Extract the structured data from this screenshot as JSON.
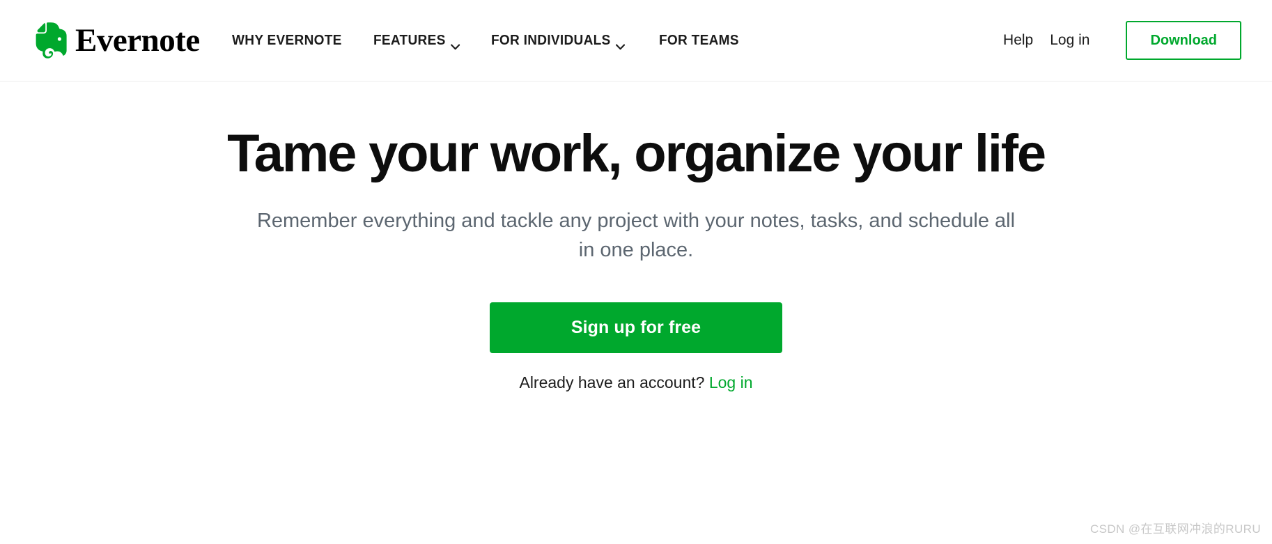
{
  "brand": {
    "name": "Evernote",
    "logo_icon": "evernote-elephant-icon",
    "logo_color": "#00a82d"
  },
  "header": {
    "nav": [
      {
        "label": "WHY EVERNOTE",
        "has_dropdown": false
      },
      {
        "label": "FEATURES",
        "has_dropdown": true
      },
      {
        "label": "FOR INDIVIDUALS",
        "has_dropdown": true
      },
      {
        "label": "FOR TEAMS",
        "has_dropdown": false
      }
    ],
    "help_label": "Help",
    "login_label": "Log in",
    "download_label": "Download"
  },
  "hero": {
    "title": "Tame your work, organize your life",
    "subtitle": "Remember everything and tackle any project with your notes, tasks, and schedule all in one place.",
    "cta_label": "Sign up for free",
    "account_prompt": "Already have an account?",
    "account_login_label": "Log in"
  },
  "watermark": {
    "text": "CSDN @在互联网冲浪的RURU"
  },
  "colors": {
    "brand_green": "#00a82d",
    "text_dark": "#1c1c1c",
    "text_muted": "#5c6670",
    "border_light": "#ececec",
    "watermark_gray": "#c8c8c8"
  }
}
